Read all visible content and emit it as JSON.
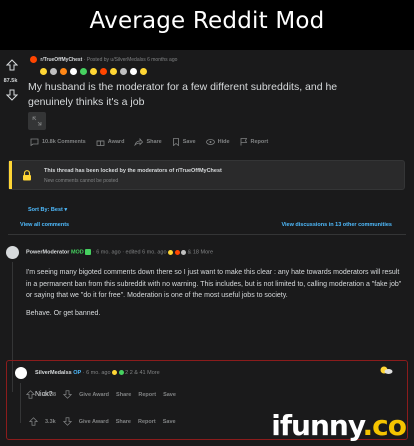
{
  "meme": {
    "title": "Average Reddit Mod"
  },
  "post": {
    "score": "87.5k",
    "subreddit": "r/TrueOffMyChest",
    "posted_by": "· Posted by u/SilverMedalss 6 months ago",
    "title": "My husband is the moderator for a few different subreddits, and he genuinely thinks it's a job",
    "awards_text": "2   49   31   41   5   2   2",
    "actions": {
      "comments": "10.8k Comments",
      "award": "Award",
      "share": "Share",
      "save": "Save",
      "hide": "Hide",
      "report": "Report"
    }
  },
  "lock_notice": {
    "title": "This thread has been locked by the moderators of r/TrueOffMyChest",
    "subtitle": "New comments cannot be posted"
  },
  "sort": {
    "label": "Sort By: Best ▾"
  },
  "comments_bar": {
    "view_all": "View all comments",
    "view_discussions": "View discussions in 13 other communities"
  },
  "comments": [
    {
      "user": "PowerModerator",
      "badge": "MOD",
      "meta": "· 6 mo. ago · edited 6 mo. ago",
      "more": "& 18 More",
      "paragraphs": [
        "I'm seeing many bigoted comments down there so I just want to make this clear : any hate towards moderators will result in a permanent ban from this subreddit with no warning. This includes, but is not limited to, calling moderation a \"fake job\" or saying that we \"do it for free\". Moderation is one of the most useful jobs to society.",
        "Behave. Or get banned."
      ],
      "score": "-6038",
      "actions": [
        "Give Award",
        "Share",
        "Report",
        "Save"
      ]
    },
    {
      "user": "SilverMedalss",
      "badge": "OP",
      "meta": "· 6 mo. ago",
      "more": "2   2 & 41 More",
      "paragraphs": [
        "Nick?"
      ],
      "score": "3.3k",
      "actions": [
        "Give Award",
        "Share",
        "Report",
        "Save"
      ]
    }
  ],
  "watermark": {
    "main": "ifunny",
    "suffix": ".co"
  },
  "colors": {
    "accent_blue": "#4fbcff",
    "lock_yellow": "#ffd635",
    "mod_green": "#46d160",
    "highlight_red": "#8b1c1c"
  }
}
